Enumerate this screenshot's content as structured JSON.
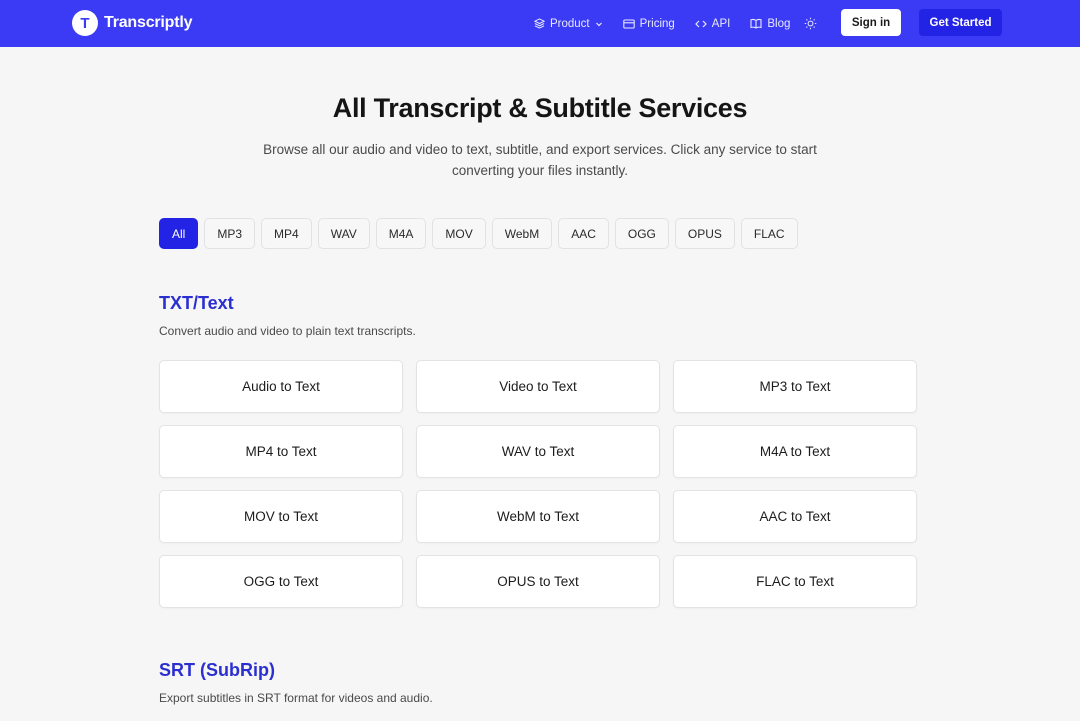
{
  "header": {
    "brand_letter": "T",
    "brand_name": "Transcriptly",
    "nav": [
      {
        "label": "Product",
        "icon": "layers-icon"
      },
      {
        "label": "Pricing",
        "icon": "card-icon"
      },
      {
        "label": "API",
        "icon": "code-icon"
      },
      {
        "label": "Blog",
        "icon": "book-icon"
      }
    ],
    "theme_icon": "sun-icon",
    "signin_label": "Sign in",
    "cta_label": "Get Started"
  },
  "hero": {
    "title": "All Transcript & Subtitle Services",
    "subtitle": "Browse all our audio and video to text, subtitle, and export services. Click any service to start converting your files instantly."
  },
  "filters": {
    "items": [
      "All",
      "MP3",
      "MP4",
      "WAV",
      "M4A",
      "MOV",
      "WebM",
      "AAC",
      "OGG",
      "OPUS",
      "FLAC"
    ],
    "selected": "All"
  },
  "sections": [
    {
      "title": "TXT/Text",
      "description": "Convert audio and video to plain text transcripts.",
      "services": [
        "Audio to Text",
        "Video to Text",
        "MP3 to Text",
        "MP4 to Text",
        "WAV to Text",
        "M4A to Text",
        "MOV to Text",
        "WebM to Text",
        "AAC to Text",
        "OGG to Text",
        "OPUS to Text",
        "FLAC to Text"
      ]
    },
    {
      "title": "SRT (SubRip)",
      "description": "Export subtitles in SRT format for videos and audio."
    }
  ],
  "colors": {
    "brand": "#3b3bf5",
    "accent": "#2323e6",
    "section_title": "#2b2fd0",
    "background": "#f6f6f7"
  }
}
